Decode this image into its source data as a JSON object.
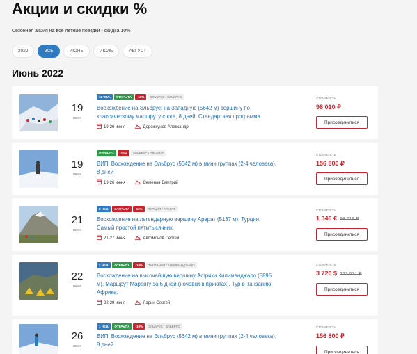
{
  "page": {
    "title": "Акции и скидки %",
    "subtitle": "Сезонная акция на все летние поездки - скидка 10%"
  },
  "filters": [
    {
      "label": "2022",
      "active": false
    },
    {
      "label": "Все",
      "active": true
    },
    {
      "label": "Июнь",
      "active": false
    },
    {
      "label": "Июль",
      "active": false
    },
    {
      "label": "Август",
      "active": false
    }
  ],
  "month_title": "Июнь 2022",
  "price_label": "стоимость",
  "join_label": "Присоединиться",
  "colors": {
    "accent": "#2e7bc4",
    "price": "#c8242e",
    "open": "#2f9a4a",
    "closed": "#c8242e"
  },
  "trips": [
    {
      "day": "19",
      "month": "июня",
      "tags": [
        {
          "text": "12 чел.",
          "style": "blue"
        },
        {
          "text": "Открыта",
          "style": "green"
        },
        {
          "text": "-10%",
          "style": "red"
        },
        {
          "text": "Эльбрус / Эльбрус",
          "style": "gray"
        }
      ],
      "title": "Восхождение на Эльбрус: на Западную (5642 м) вершину по классическому маршруту с юга, 8 дней. Стандартная программа",
      "dates": "19-26 июня",
      "guide": "Дорожкунов Александр",
      "price": "98 010 ₽",
      "old_price": ""
    },
    {
      "day": "19",
      "month": "июня",
      "tags": [
        {
          "text": "Открыта",
          "style": "green"
        },
        {
          "text": "-10%",
          "style": "red"
        },
        {
          "text": "Эльбрус / Эльбрус",
          "style": "gray"
        }
      ],
      "title": "ВИП. Восхождение на Эльбрус (5642 м) в мини группах (2-4 человека), 8 дней",
      "dates": "19-26 июня",
      "guide": "Семенов Дмитрий",
      "price": "156 800 ₽",
      "old_price": ""
    },
    {
      "day": "21",
      "month": "июня",
      "tags": [
        {
          "text": "8 чел.",
          "style": "blue"
        },
        {
          "text": "Закрыта",
          "style": "red"
        },
        {
          "text": "-10%",
          "style": "red"
        },
        {
          "text": "Турция / Арарат",
          "style": "gray"
        }
      ],
      "title": "Восхождение на легендарную вершину Арарат (5137 м), Турция. Самый простой пятитысячник.",
      "dates": "21-27 июня",
      "guide": "Автомонов Сергей",
      "price": "1 340 €",
      "old_price": "98 719 ₽"
    },
    {
      "day": "22",
      "month": "июня",
      "tags": [
        {
          "text": "2 чел.",
          "style": "blue"
        },
        {
          "text": "Открыта",
          "style": "green"
        },
        {
          "text": "-10%",
          "style": "red"
        },
        {
          "text": "Танзания / Килиманджаро",
          "style": "gray"
        }
      ],
      "title": "Восхождение на высочайшую вершину Африки Килиманджаро (5895 м). Маршрут Марангу за 6 дней (ночевки в приютах). Тур в Танзанию, Африка.",
      "dates": "22-29 июня",
      "guide": "Ларин Сергей",
      "price": "3 720 $",
      "old_price": "263 531 ₽"
    },
    {
      "day": "26",
      "month": "июня",
      "tags": [
        {
          "text": "1 чел.",
          "style": "blue"
        },
        {
          "text": "Открыта",
          "style": "green"
        },
        {
          "text": "-10%",
          "style": "red"
        },
        {
          "text": "Эльбрус / Эльбрус",
          "style": "gray"
        }
      ],
      "title": "ВИП. Восхождение на Эльбрус (5642 м) в мини группах (2-4 человека), 8 дней",
      "dates": "",
      "guide": "",
      "price": "156 800 ₽",
      "old_price": ""
    }
  ]
}
